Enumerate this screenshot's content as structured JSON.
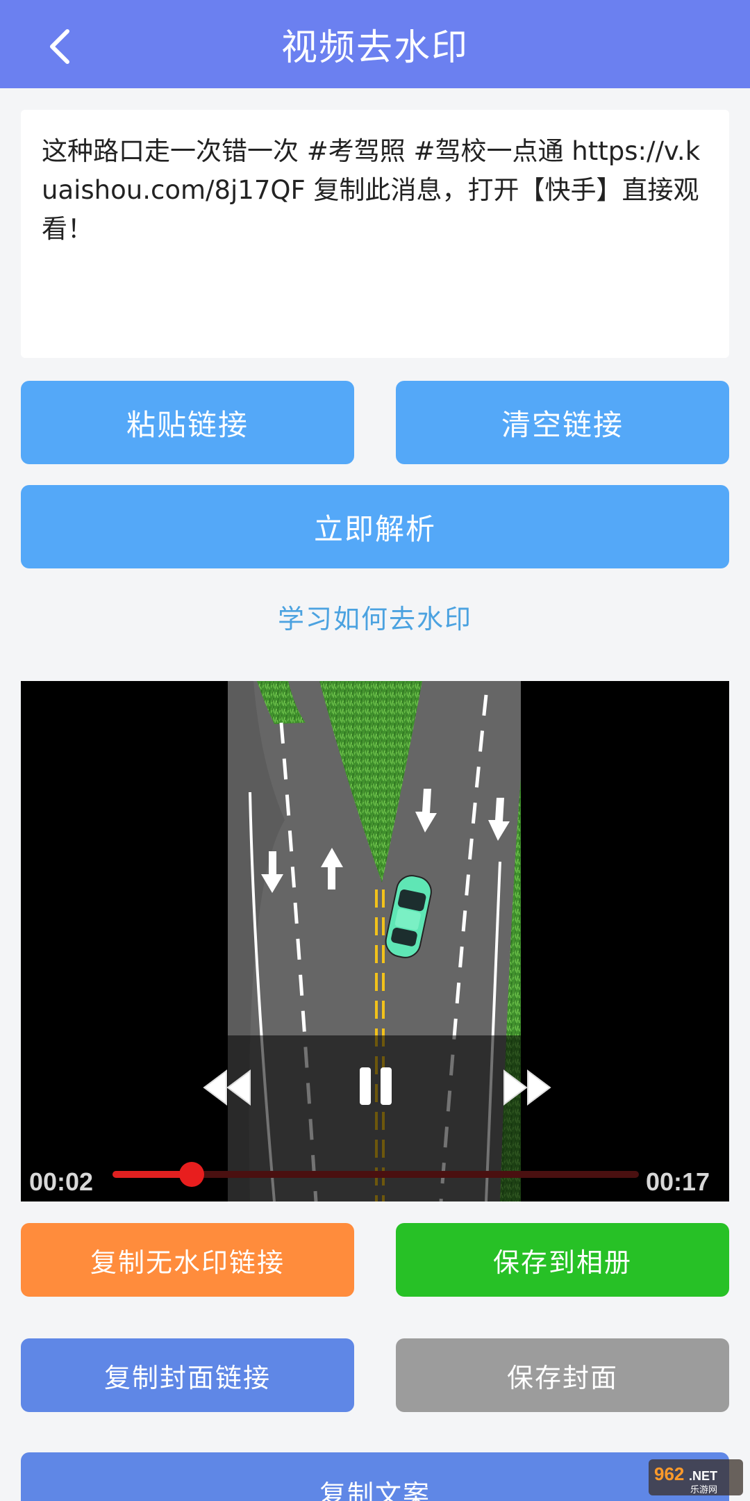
{
  "header": {
    "title": "视频去水印"
  },
  "link_input": {
    "value": "这种路口走一次错一次 #考驾照 #驾校一点通 https://v.kuaishou.com/8j17QF 复制此消息，打开【快手】直接观看！"
  },
  "buttons": {
    "paste": "粘贴链接",
    "clear": "清空链接",
    "parse": "立即解析",
    "copy_no_watermark": "复制无水印链接",
    "save_album": "保存到相册",
    "copy_cover": "复制封面链接",
    "save_cover": "保存封面",
    "copy_text": "复制文案"
  },
  "learn_link": "学习如何去水印",
  "player": {
    "current_time": "00:02",
    "duration": "00:17",
    "progress": 0.15
  },
  "watermark": {
    "text": "962.NET",
    "sub": "乐游网"
  },
  "colors": {
    "header": "#6b80f0",
    "primary_button": "#54a8f8",
    "orange_button": "#ff8c3c",
    "green_button": "#27c126",
    "royal_button": "#5f87e6",
    "gray_button": "#9c9c9c",
    "link": "#4ba2e0",
    "progress": "#e02020"
  }
}
